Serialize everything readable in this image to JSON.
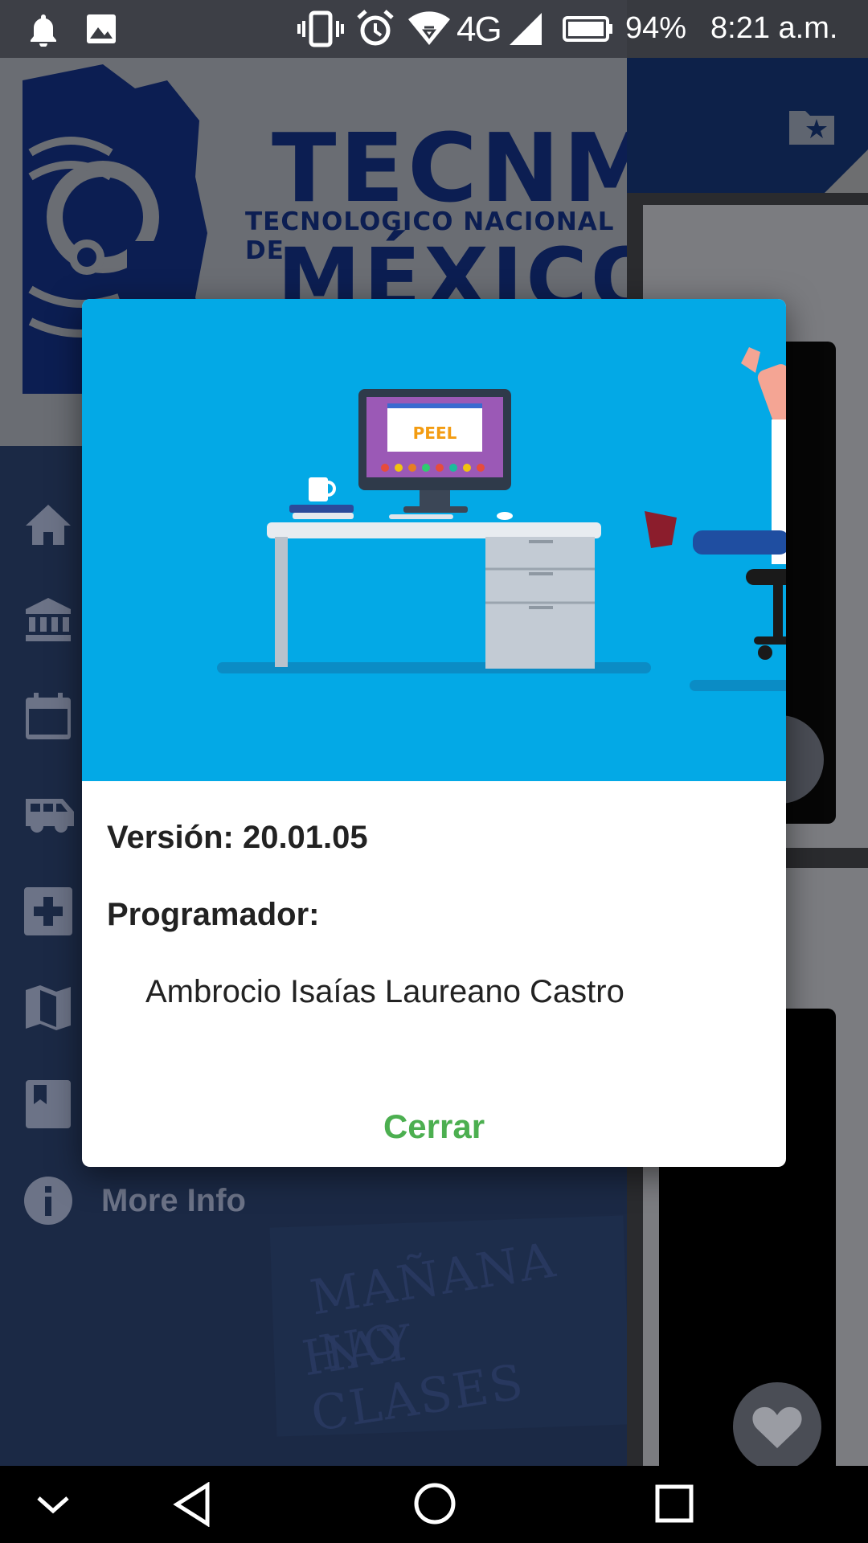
{
  "status_bar": {
    "network": "4G",
    "battery_percent": "94%",
    "time": "8:21 a.m."
  },
  "drawer": {
    "logo": {
      "title": "TECNM",
      "subtitle": "TECNOLOGICO NACIONAL DE",
      "country": "MÉXICO"
    },
    "items": [
      {
        "icon": "home-icon"
      },
      {
        "icon": "institution-icon"
      },
      {
        "icon": "calendar-icon"
      },
      {
        "icon": "bus-icon"
      },
      {
        "icon": "medical-icon"
      },
      {
        "icon": "map-icon"
      },
      {
        "icon": "bookmark-book-icon"
      },
      {
        "icon": "info-icon",
        "label": "More Info"
      }
    ],
    "background_stamp": [
      "MAÑANA NO",
      "HAY CLASES"
    ]
  },
  "dialog": {
    "hero_screen_text": "PEEL",
    "version_line": "Versión: 20.01.05",
    "programmer_label": "Programador:",
    "programmer_name": "Ambrocio Isaías Laureano Castro",
    "close_label": "Cerrar"
  },
  "colors": {
    "accent_green": "#4caf50",
    "hero_blue": "#03a9e6",
    "drawer_navy": "#1b2945",
    "logo_navy": "#0c1e52"
  }
}
